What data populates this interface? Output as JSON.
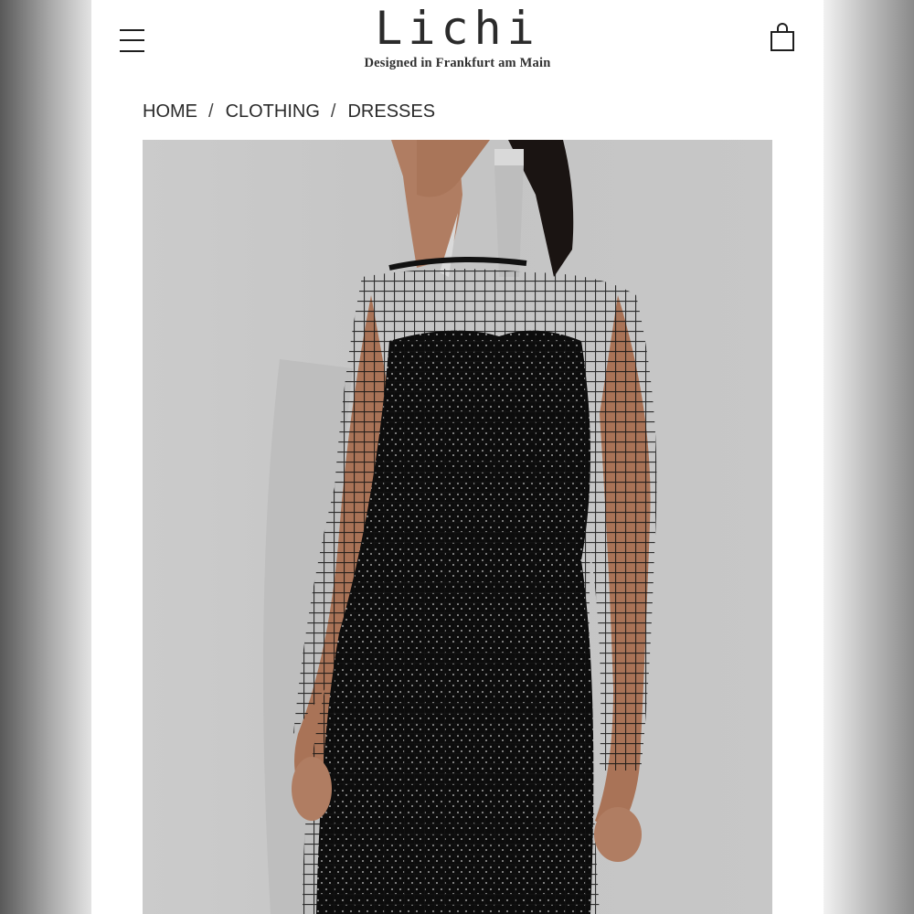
{
  "brand": {
    "logo_text": "Lichi",
    "tagline": "Designed in Frankfurt am Main"
  },
  "header": {
    "menu_icon": "hamburger-menu-icon",
    "cart_icon": "shopping-bag-icon"
  },
  "breadcrumb": {
    "items": [
      {
        "label": "HOME"
      },
      {
        "label": "CLOTHING"
      },
      {
        "label": "DRESSES"
      }
    ],
    "separator": "/"
  },
  "product": {
    "image_alt": "",
    "colors": {
      "background": "#c9c9c9",
      "dress": "#111111",
      "skin": "#b48368"
    }
  }
}
